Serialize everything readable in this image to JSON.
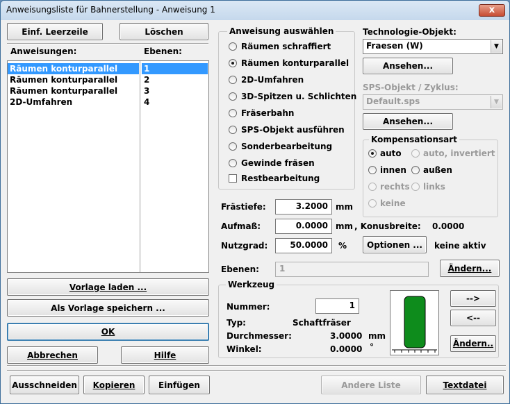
{
  "window": {
    "title": "Anweisungsliste für Bahnerstellung - Anweisung 1",
    "close_glyph": "x"
  },
  "left": {
    "insert_empty_label": "Einf. Leerzeile",
    "insert_empty_u": "E",
    "delete_label": "Löschen",
    "delete_u": "L",
    "col_instructions": "Anweisungen:",
    "col_levels": "Ebenen:",
    "rows": [
      {
        "instruction": "Räumen konturparallel",
        "level": "1",
        "selected": true
      },
      {
        "instruction": "Räumen konturparallel",
        "level": "2",
        "selected": false
      },
      {
        "instruction": "Räumen konturparallel",
        "level": "3",
        "selected": false
      },
      {
        "instruction": "2D-Umfahren",
        "level": "4",
        "selected": false
      }
    ],
    "load_template_label": "Vorlage laden ...",
    "save_template_label": "Als Vorlage speichern ...",
    "ok_label": "OK",
    "cancel_label": "Abbrechen",
    "help_label": "Hilfe"
  },
  "select": {
    "legend": "Anweisung auswählen",
    "options": [
      {
        "label": "Räumen schraffiert",
        "checked": false
      },
      {
        "label": "Räumen konturparallel",
        "checked": true
      },
      {
        "label": "2D-Umfahren",
        "checked": false
      },
      {
        "label": "3D-Spitzen u. Schlichten",
        "checked": false
      },
      {
        "label": "Fräserbahn",
        "checked": false
      },
      {
        "label": "SPS-Objekt ausführen",
        "checked": false
      },
      {
        "label": "Sonderbearbeitung",
        "checked": false
      },
      {
        "label": "Gewinde fräsen",
        "checked": false
      }
    ],
    "rest_label": "Restbearbeitung",
    "rest_checked": false
  },
  "technology": {
    "label": "Technologie-Objekt:",
    "value": "Fraesen (W)",
    "view_label": "Ansehen...",
    "sps_label": "SPS-Objekt / Zyklus:",
    "sps_value": "Default.sps",
    "sps_view_label": "Ansehen..."
  },
  "compensation": {
    "legend": "Kompensationsart",
    "auto": "auto",
    "auto_inv": "auto, invertiert",
    "inside": "innen",
    "outside": "außen",
    "right": "rechts",
    "left": "links",
    "none": "keine",
    "selected": "auto"
  },
  "params": {
    "depth_label": "Frästiefe:",
    "depth_value": "3.2000",
    "depth_unit": "mm",
    "allowance_label": "Aufmaß:",
    "allowance_value": "0.0000",
    "allowance_unit": "mm",
    "cone_label": ", Konusbreite:",
    "cone_value": "0.0000",
    "util_label": "Nutzgrad:",
    "util_value": "50.0000",
    "util_unit": "%",
    "options_label": "Optionen ...",
    "options_status": "keine aktiv",
    "levels_label": "Ebenen:",
    "levels_value": "1",
    "change_label": "Ändern..."
  },
  "tool": {
    "legend": "Werkzeug",
    "number_label": "Nummer:",
    "number_value": "1",
    "type_label": "Typ:",
    "type_value": "Schaftfräser",
    "diameter_label": "Durchmesser:",
    "diameter_value": "3.0000",
    "diameter_unit": "mm",
    "angle_label": "Winkel:",
    "angle_value": "0.0000",
    "angle_unit": "°",
    "next_label": "-->",
    "prev_label": "<--",
    "change_label": "Ändern..",
    "tool_color": "#0e8c1c"
  },
  "bottom": {
    "cut_label": "Ausschneiden",
    "copy_label": "Kopieren",
    "paste_label": "Einfügen",
    "other_list_label": "Andere Liste",
    "textfile_label": "Textdatei"
  }
}
